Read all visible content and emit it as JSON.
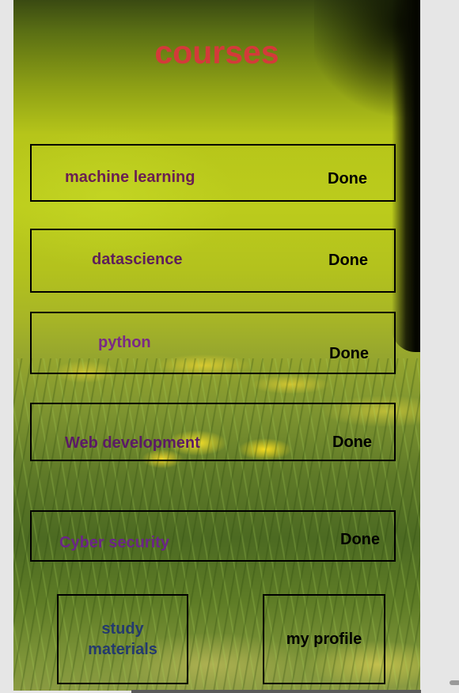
{
  "header": {
    "title": "courses"
  },
  "courses": [
    {
      "name": "machine learning",
      "action": "Done"
    },
    {
      "name": "datascience",
      "action": "Done"
    },
    {
      "name": "python",
      "action": "Done"
    },
    {
      "name": "Web development",
      "action": "Done"
    },
    {
      "name": "Cyber security",
      "action": "Done"
    }
  ],
  "nav": {
    "study_materials": "study\nmaterials",
    "my_profile": "my profile"
  },
  "colors": {
    "title": "#d43a3a",
    "course_name": "#6a1f52",
    "course_name_alt": "#6b2587",
    "nav_study": "#243a6e",
    "nav_profile": "#000000"
  }
}
